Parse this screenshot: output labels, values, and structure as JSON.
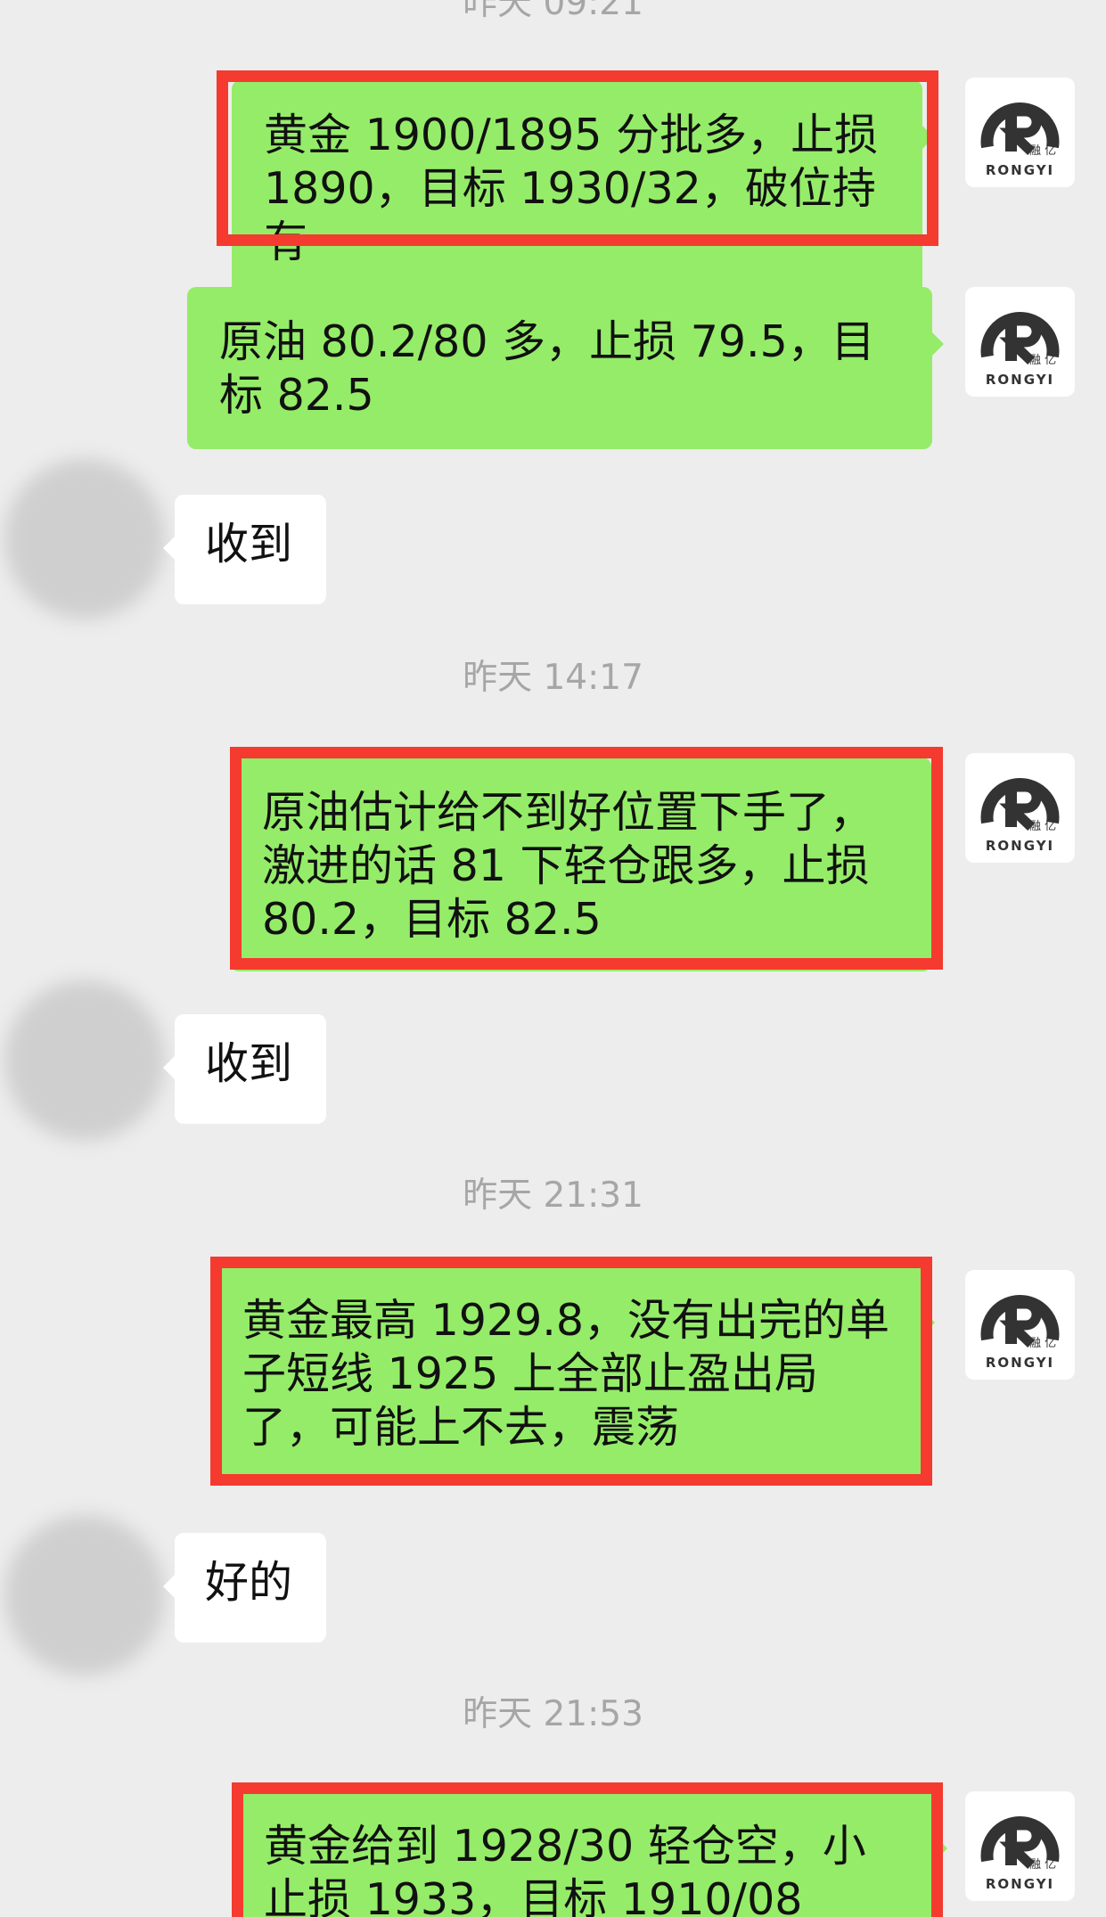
{
  "avatar": {
    "brand_text": "RONGYI",
    "brand_cn": "融 亿",
    "color": "#333333"
  },
  "messages": [
    {
      "type": "timestamp",
      "text": "昨天 09:21"
    },
    {
      "type": "sent",
      "text": "黄金 1900/1895 分批多，止损 1890，目标 1930/32，破位持有",
      "highlighted": true
    },
    {
      "type": "sent",
      "text": "原油 80.2/80 多，止损 79.5，目标 82.5",
      "highlighted": false
    },
    {
      "type": "received",
      "text": "收到"
    },
    {
      "type": "timestamp",
      "text": "昨天 14:17"
    },
    {
      "type": "sent",
      "text": "原油估计给不到好位置下手了，激进的话 81 下轻仓跟多，止损 80.2，目标 82.5",
      "highlighted": true
    },
    {
      "type": "received",
      "text": "收到"
    },
    {
      "type": "timestamp",
      "text": "昨天 21:31"
    },
    {
      "type": "sent",
      "text": "黄金最高 1929.8，没有出完的单子短线 1925 上全部止盈出局了，可能上不去，震荡",
      "highlighted": true
    },
    {
      "type": "received",
      "text": "好的"
    },
    {
      "type": "timestamp",
      "text": "昨天 21:53"
    },
    {
      "type": "sent",
      "text": "黄金给到 1928/30 轻仓空，小止损 1933，目标 1910/08",
      "highlighted": true
    }
  ],
  "colors": {
    "sent_bubble": "#95ec69",
    "received_bubble": "#ffffff",
    "highlight_box": "#f53a2f",
    "background": "#ededed"
  }
}
